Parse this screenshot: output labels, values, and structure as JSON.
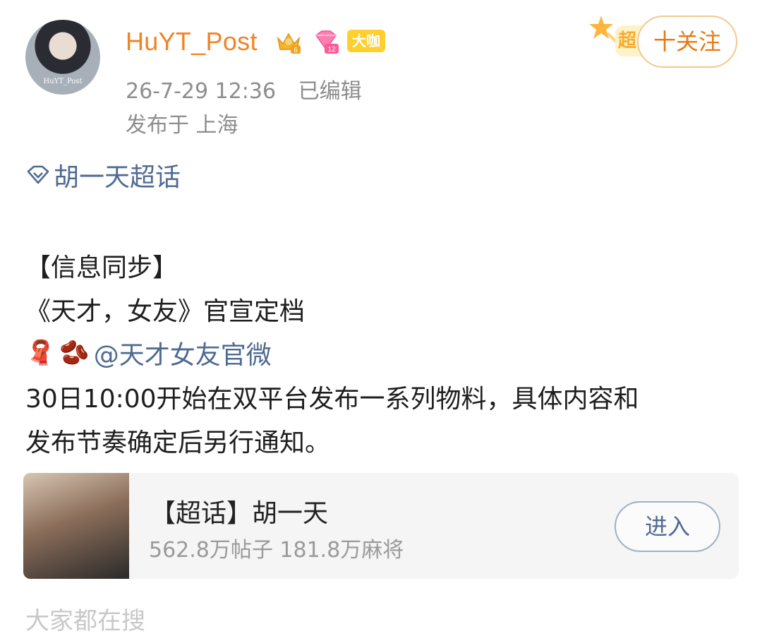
{
  "post": {
    "username": "HuYT_Post",
    "badge_crown_level": "6",
    "badge_gem_level": "12",
    "badge_daka": "大咖",
    "avatar_caption": "HuYT_Post",
    "timestamp": "26-7-29 12:36",
    "edited": "已编辑",
    "location": "发布于 上海",
    "super_tag": "超",
    "follow_label": "十关注"
  },
  "topic": {
    "label": "胡一天超话"
  },
  "content": {
    "line1": "【信息同步】",
    "line2": "《天才，女友》官宣定档",
    "emoji1": "🧣",
    "emoji2": "🫘",
    "mention": "@天才女友官微",
    "line4": "30日10:00开始在双平台发布一系列物料，具体内容和",
    "line5": "发布节奏确定后另行通知。"
  },
  "card": {
    "title": "【超话】胡一天",
    "stats": "562.8万帖子 181.8万麻将",
    "enter_label": "进入"
  },
  "footer": {
    "cut_text": "大家都在搜"
  },
  "colors": {
    "username": "#f18324",
    "link": "#4f6a92",
    "meta": "#8d8d8d",
    "follow": "#e67b12"
  }
}
